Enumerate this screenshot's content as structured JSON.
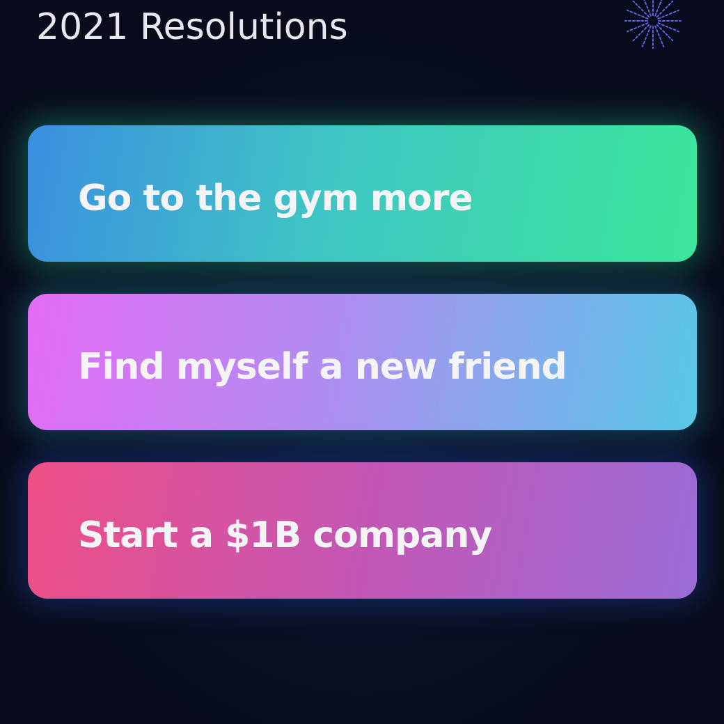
{
  "header": {
    "title": "2021 Resolutions",
    "decoration_icon": "firework-icon"
  },
  "resolutions": [
    {
      "label": "Go to the gym more",
      "gradient": [
        "#3b8fe0",
        "#3be79a"
      ]
    },
    {
      "label": "Find myself a new friend",
      "gradient": [
        "#e46cf5",
        "#58c8e8"
      ]
    },
    {
      "label": "Start a $1B company",
      "gradient": [
        "#ee4f86",
        "#9a6cd6"
      ]
    }
  ],
  "colors": {
    "background": "#080c1c",
    "title_text": "#e8e8ee",
    "card_text": "#f4f4f6",
    "firework": "#5a64e0"
  }
}
